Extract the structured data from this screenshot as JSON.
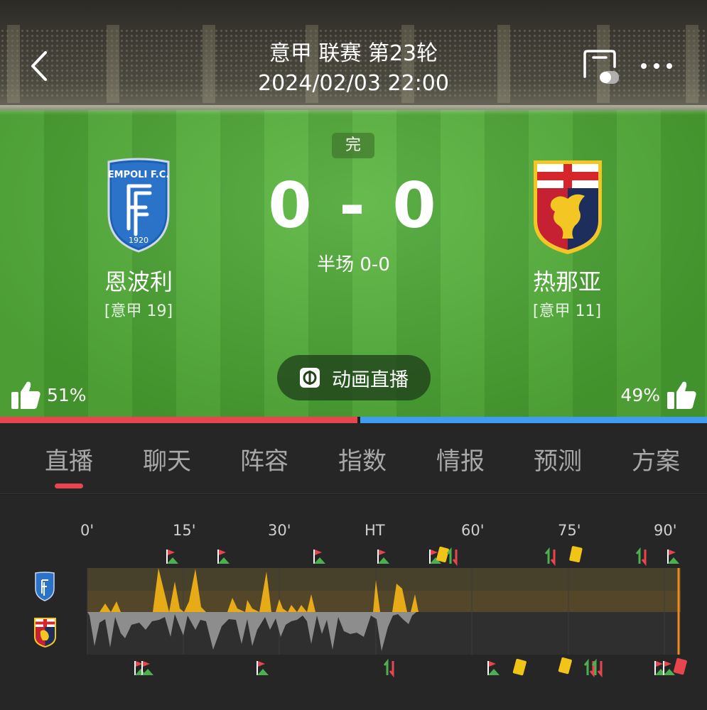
{
  "header": {
    "round_title": "意甲 联赛 第23轮",
    "match_time": "2024/02/03 22:00",
    "back_icon": "chevron-left-icon",
    "screen_icon": "screen-mode-icon",
    "more_icon": "more-dots-icon"
  },
  "match": {
    "status": "完",
    "score": "0 - 0",
    "halftime": "半场 0-0",
    "home": {
      "name": "恩波利",
      "rank": "[意甲 19]",
      "logo_text": "EMPOLI F.C.",
      "logo_year": "1920"
    },
    "away": {
      "name": "热那亚",
      "rank": "[意甲 11]"
    }
  },
  "animation_button": {
    "label": "动画直播",
    "icon": "animation-live-icon"
  },
  "support": {
    "home_pct": "51%",
    "away_pct": "49%",
    "home_share": 0.51,
    "home_color": "#e8454f",
    "away_color": "#3f9cf0"
  },
  "tabs": [
    {
      "label": "直播",
      "active": true
    },
    {
      "label": "聊天",
      "active": false
    },
    {
      "label": "阵容",
      "active": false
    },
    {
      "label": "指数",
      "active": false
    },
    {
      "label": "情报",
      "active": false
    },
    {
      "label": "预测",
      "active": false
    },
    {
      "label": "方案",
      "active": false
    }
  ],
  "timeline": {
    "ticks": [
      "0'",
      "15'",
      "30'",
      "HT",
      "60'",
      "75'",
      "90'"
    ],
    "home_color": "#e6ab16",
    "away_color": "#8d8d8d",
    "current_minute": 93
  }
}
